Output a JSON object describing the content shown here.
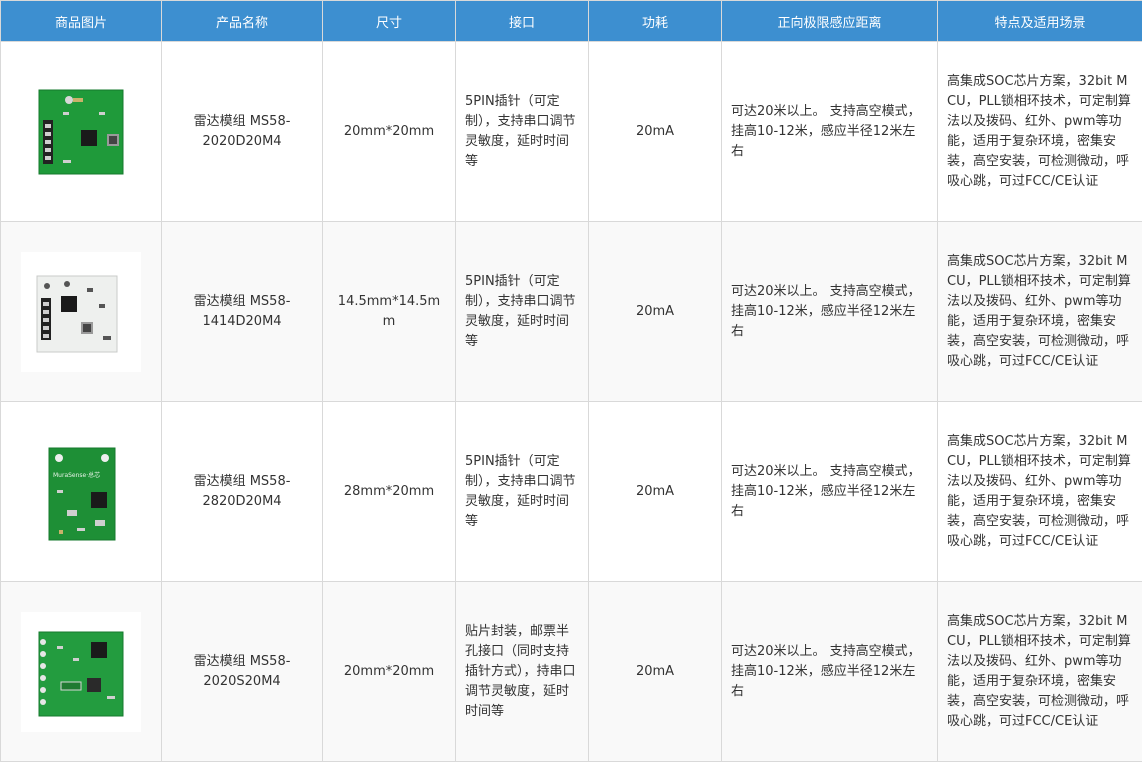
{
  "headers": [
    "商品图片",
    "产品名称",
    "尺寸",
    "接口",
    "功耗",
    "正向极限感应距离",
    "特点及适用场景"
  ],
  "rows": [
    {
      "image_icon": "radar-module-2020d-image",
      "name_line1": "雷达模组 MS58-",
      "name_line2": "2020D20M4",
      "size": "20mm*20mm",
      "interface": "5PIN插针（可定制），支持串口调节灵敏度，延时时间等",
      "power": "20mA",
      "distance": "可达20米以上。 支持高空模式，挂高10-12米，感应半径12米左右",
      "features": "高集成SOC芯片方案，32bit MCU，PLL锁相环技术，可定制算法以及拨码、红外、pwm等功能，适用于复杂环境，密集安装，高空安装，可检测微动，呼吸心跳，可过FCC/CE认证"
    },
    {
      "image_icon": "radar-module-1414d-image",
      "name_line1": "雷达模组 MS58-",
      "name_line2": "1414D20M4",
      "size": "14.5mm*14.5mm",
      "interface": "5PIN插针（可定制），支持串口调节灵敏度，延时时间等",
      "power": "20mA",
      "distance": "可达20米以上。 支持高空模式，挂高10-12米，感应半径12米左右",
      "features": "高集成SOC芯片方案，32bit MCU，PLL锁相环技术，可定制算法以及拨码、红外、pwm等功能，适用于复杂环境，密集安装，高空安装，可检测微动，呼吸心跳，可过FCC/CE认证"
    },
    {
      "image_icon": "radar-module-2820d-image",
      "name_line1": "雷达模组 MS58-",
      "name_line2": "2820D20M4",
      "size": "28mm*20mm",
      "interface": "5PIN插针（可定制），支持串口调节灵敏度，延时时间等",
      "power": "20mA",
      "distance": "可达20米以上。 支持高空模式，挂高10-12米，感应半径12米左右",
      "features": "高集成SOC芯片方案，32bit MCU，PLL锁相环技术，可定制算法以及拨码、红外、pwm等功能，适用于复杂环境，密集安装，高空安装，可检测微动，呼吸心跳，可过FCC/CE认证"
    },
    {
      "image_icon": "radar-module-2020s-image",
      "name_line1": "雷达模组 MS58-",
      "name_line2": "2020S20M4",
      "size": "20mm*20mm",
      "interface": "贴片封装，邮票半孔接口（同时支持插针方式），持串口调节灵敏度，延时时间等",
      "power": "20mA",
      "distance": "可达20米以上。 支持高空模式，挂高10-12米，感应半径12米左右",
      "features": "高集成SOC芯片方案，32bit MCU，PLL锁相环技术，可定制算法以及拨码、红外、pwm等功能，适用于复杂环境，密集安装，高空安装，可检测微动，呼吸心跳，可过FCC/CE认证"
    }
  ],
  "brand_silkscreen": "MuraSense·总芯",
  "colors": {
    "header_bg": "#3d8fd0",
    "header_text": "#ffffff",
    "pcb_green": "#1f9a3a",
    "pcb_white": "#eef0ee",
    "border": "#d9d9d9"
  }
}
